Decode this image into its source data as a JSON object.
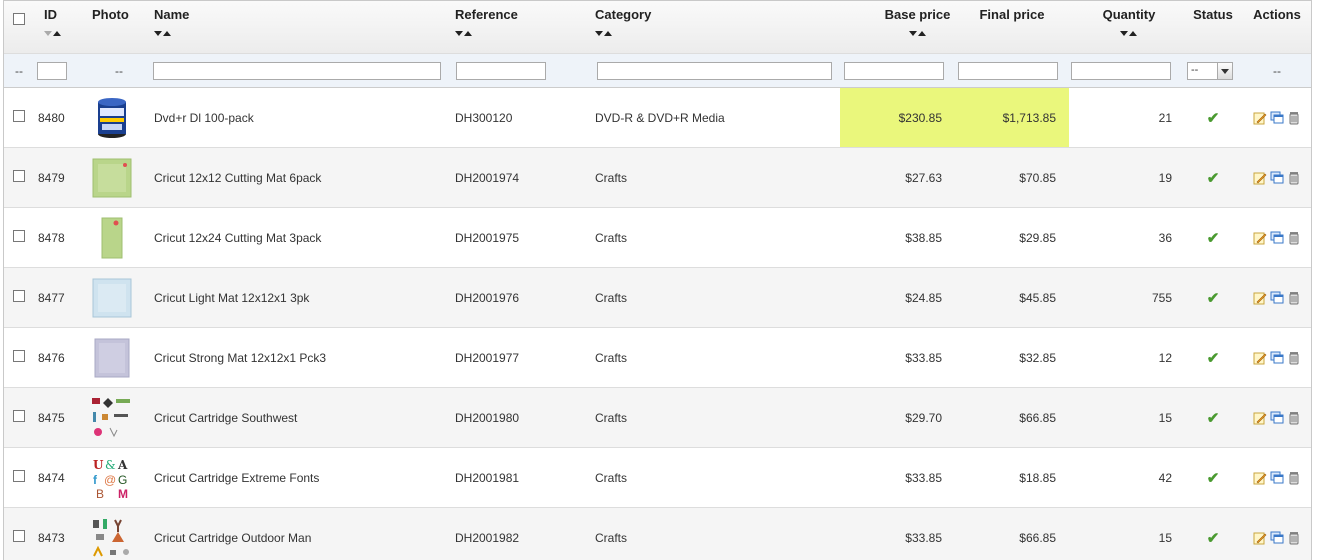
{
  "headers": {
    "id": "ID",
    "photo": "Photo",
    "name": "Name",
    "reference": "Reference",
    "category": "Category",
    "base_price": "Base price",
    "final_price": "Final price",
    "quantity": "Quantity",
    "status": "Status",
    "actions": "Actions"
  },
  "filters": {
    "dash": "--",
    "photo_dash": "--",
    "status_select": "--",
    "actions_dash": "--"
  },
  "highlight_color": "#eaf77c",
  "status_color": "#4a9a30",
  "rows": [
    {
      "id": "8480",
      "name": "Dvd+r Dl 100-pack",
      "reference": "DH300120",
      "category": "DVD-R & DVD+R Media",
      "base": "$230.85",
      "final": "$1,713.85",
      "qty": "21",
      "status": "✔",
      "photo": "dvd-spindle-image"
    },
    {
      "id": "8479",
      "name": "Cricut 12x12 Cutting Mat 6pack",
      "reference": "DH2001974",
      "category": "Crafts",
      "base": "$27.63",
      "final": "$70.85",
      "qty": "19",
      "status": "✔",
      "photo": "green-mat-image"
    },
    {
      "id": "8478",
      "name": "Cricut 12x24 Cutting Mat 3pack",
      "reference": "DH2001975",
      "category": "Crafts",
      "base": "$38.85",
      "final": "$29.85",
      "qty": "36",
      "status": "✔",
      "photo": "green-long-mat-image"
    },
    {
      "id": "8477",
      "name": "Cricut Light Mat 12x12x1 3pk",
      "reference": "DH2001976",
      "category": "Crafts",
      "base": "$24.85",
      "final": "$45.85",
      "qty": "755",
      "status": "✔",
      "photo": "blue-mat-image"
    },
    {
      "id": "8476",
      "name": "Cricut Strong Mat 12x12x1 Pck3",
      "reference": "DH2001977",
      "category": "Crafts",
      "base": "$33.85",
      "final": "$32.85",
      "qty": "12",
      "status": "✔",
      "photo": "purple-mat-image"
    },
    {
      "id": "8475",
      "name": "Cricut Cartridge Southwest",
      "reference": "DH2001980",
      "category": "Crafts",
      "base": "$29.70",
      "final": "$66.85",
      "qty": "15",
      "status": "✔",
      "photo": "southwest-cartridge-image"
    },
    {
      "id": "8474",
      "name": "Cricut Cartridge Extreme Fonts",
      "reference": "DH2001981",
      "category": "Crafts",
      "base": "$33.85",
      "final": "$18.85",
      "qty": "42",
      "status": "✔",
      "photo": "fonts-cartridge-image"
    },
    {
      "id": "8473",
      "name": "Cricut Cartridge Outdoor Man",
      "reference": "DH2001982",
      "category": "Crafts",
      "base": "$33.85",
      "final": "$66.85",
      "qty": "15",
      "status": "✔",
      "photo": "outdoor-cartridge-image"
    }
  ]
}
